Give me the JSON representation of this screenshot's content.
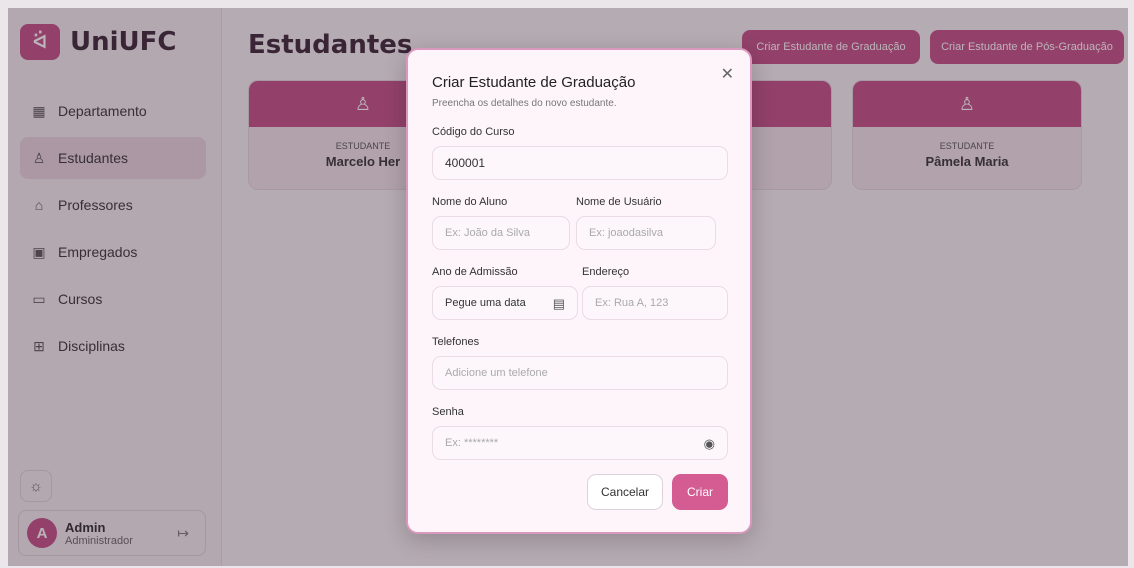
{
  "sidebar": {
    "logo_text": "UniUFC",
    "items": [
      {
        "label": "Departamento",
        "icon": "building-icon"
      },
      {
        "label": "Estudantes",
        "icon": "user-icon"
      },
      {
        "label": "Professores",
        "icon": "graduation-cap-icon"
      },
      {
        "label": "Empregados",
        "icon": "id-badge-icon"
      },
      {
        "label": "Cursos",
        "icon": "calendar-icon"
      },
      {
        "label": "Disciplinas",
        "icon": "blocks-icon"
      }
    ],
    "active_index": 1,
    "user": {
      "initial": "A",
      "name": "Admin",
      "role": "Administrador"
    }
  },
  "main": {
    "title": "Estudantes",
    "buttons": {
      "create_grad": "Criar Estudante de Graduação",
      "create_postgrad": "Criar Estudante de Pós-Graduação"
    },
    "cards": [
      {
        "label": "ESTUDANTE",
        "name": "Marcelo Her"
      },
      {
        "label": "ESTUDANTE",
        "name": "Pâmela Maria"
      }
    ]
  },
  "modal": {
    "title": "Criar Estudante de Graduação",
    "subtitle": "Preencha os detalhes do novo estudante.",
    "fields": {
      "course_code_label": "Código do Curso",
      "course_code_value": "400001",
      "student_name_label": "Nome do Aluno",
      "student_name_placeholder": "Ex: João da Silva",
      "username_label": "Nome de Usuário",
      "username_placeholder": "Ex: joaodasilva",
      "admission_label": "Ano de Admissão",
      "admission_placeholder": "Pegue uma data",
      "address_label": "Endereço",
      "address_placeholder": "Ex: Rua A, 123",
      "phones_label": "Telefones",
      "phones_placeholder": "Adicione um telefone",
      "password_label": "Senha",
      "password_placeholder": "Ex: ********"
    },
    "cancel_label": "Cancelar",
    "create_label": "Criar"
  },
  "colors": {
    "accent": "#c24f86",
    "overlay": "rgba(60,40,55,0.35)"
  }
}
